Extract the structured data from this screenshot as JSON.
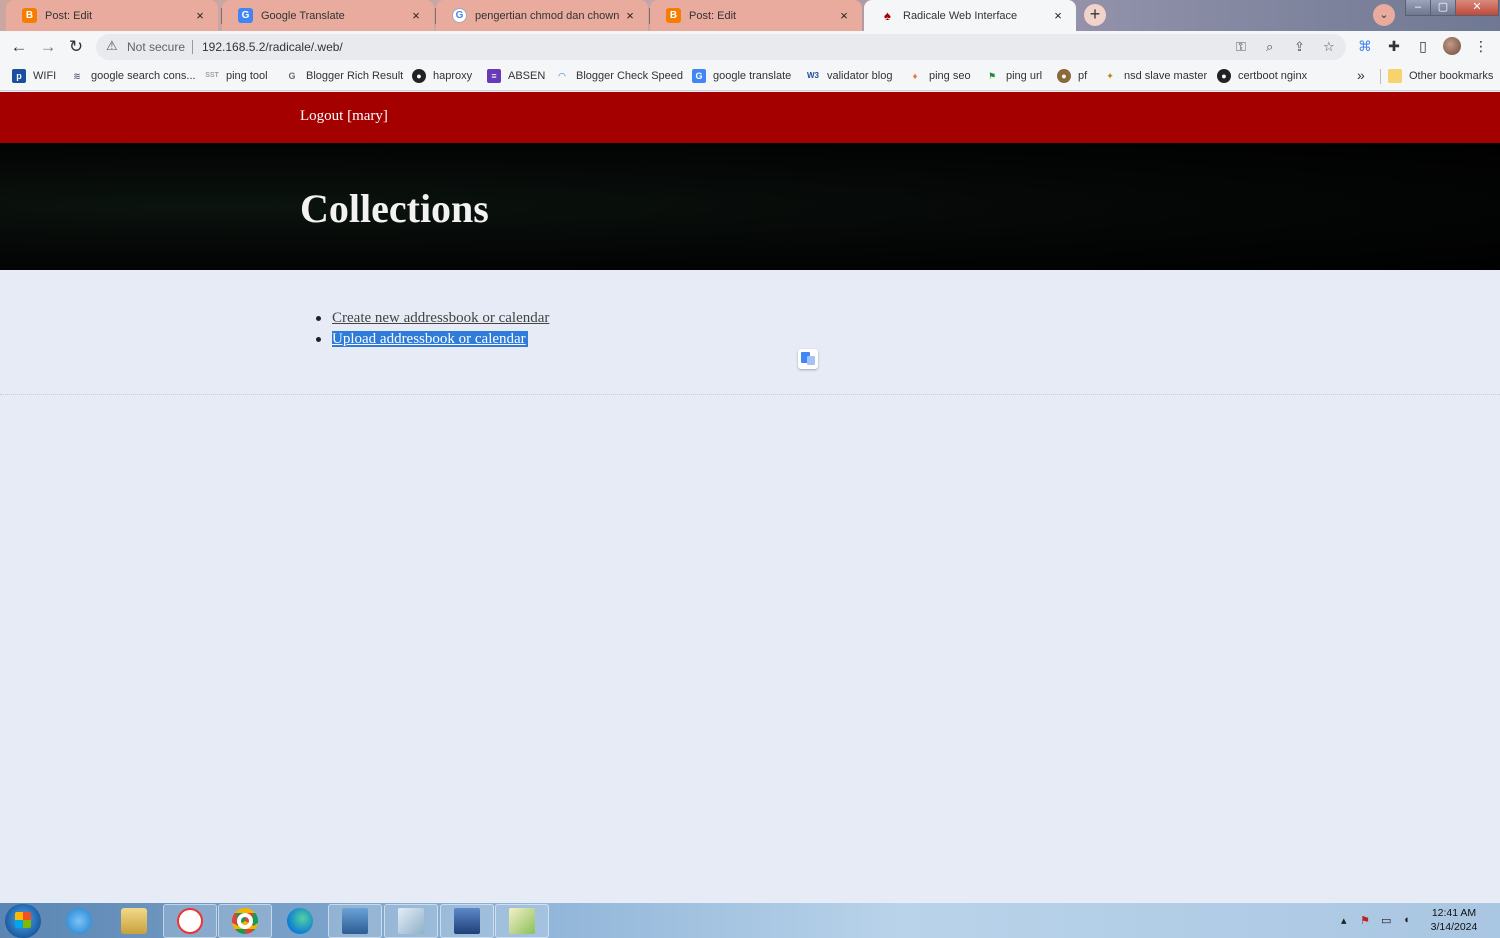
{
  "browser": {
    "tabs": [
      {
        "title": "Post: Edit",
        "favicon": "blogger-icon",
        "active": false
      },
      {
        "title": "Google Translate",
        "favicon": "google-translate-icon",
        "active": false
      },
      {
        "title": "pengertian chmod dan chown - ",
        "favicon": "google-icon",
        "active": false
      },
      {
        "title": "Post: Edit",
        "favicon": "blogger-icon",
        "active": false
      },
      {
        "title": "Radicale Web Interface",
        "favicon": "radicale-icon",
        "active": true
      }
    ],
    "close_glyph": "×",
    "new_tab_glyph": "+",
    "tab_search_glyph": "⌄",
    "window_controls": {
      "minimize": "–",
      "maximize": "▢",
      "close": "✕"
    },
    "address": {
      "security_label": "Not secure",
      "url": "192.168.5.2/radicale/.web/"
    },
    "bookmarks": [
      {
        "label": "WIFI",
        "icon": "wifi-bookmark-icon",
        "color": "#1a4fa0"
      },
      {
        "label": "google search cons...",
        "icon": "search-console-icon",
        "color": "#5f6b7a"
      },
      {
        "label": "ping tool",
        "icon": "ping-tool-icon",
        "color": "#9aa0a6"
      },
      {
        "label": "Blogger Rich Result",
        "icon": "google-icon",
        "color": "#6b6b6b"
      },
      {
        "label": "haproxy",
        "icon": "github-icon",
        "color": "#222222"
      },
      {
        "label": "ABSEN",
        "icon": "forms-icon",
        "color": "#673ab7"
      },
      {
        "label": "Blogger Check Speed",
        "icon": "speed-icon",
        "color": "#1a73e8"
      },
      {
        "label": "google translate",
        "icon": "google-translate-icon",
        "color": "#4285f4"
      },
      {
        "label": "validator blog",
        "icon": "w3c-icon",
        "color": "#1a4fa0"
      },
      {
        "label": "ping seo",
        "icon": "ping-seo-icon",
        "color": "#e8734a"
      },
      {
        "label": "ping url",
        "icon": "ping-url-icon",
        "color": "#1f8a3a"
      },
      {
        "label": "pf",
        "icon": "pf-icon",
        "color": "#8a6a3a"
      },
      {
        "label": "nsd slave master",
        "icon": "nsd-icon",
        "color": "#b8860b"
      },
      {
        "label": "certboot nginx",
        "icon": "github-icon",
        "color": "#222222"
      }
    ],
    "more_bookmarks_glyph": "»",
    "other_bookmarks": "Other bookmarks"
  },
  "page": {
    "logout_label": "Logout [mary]",
    "title": "Collections",
    "actions": [
      {
        "label": "Create new addressbook or calendar",
        "selected": false
      },
      {
        "label": "Upload addressbook or calendar",
        "selected": true
      }
    ],
    "colors": {
      "nav_bar": "#a40000",
      "selection": "#2f7bd9"
    }
  },
  "taskbar": {
    "apps": [
      "internet-explorer-icon",
      "file-explorer-icon",
      "yandex-icon",
      "chrome-icon",
      "edge-icon",
      "remote-desktop-icon",
      "app-icon",
      "network-tool-icon",
      "editor-icon"
    ],
    "clock_time": "12:41 AM",
    "clock_date": "3/14/2024"
  }
}
